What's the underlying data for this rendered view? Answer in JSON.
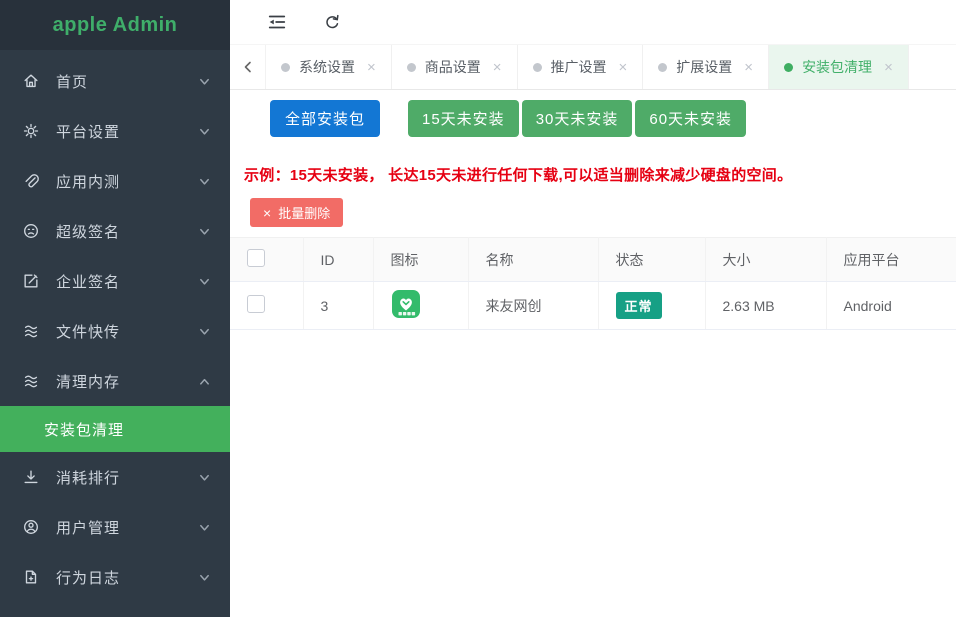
{
  "colors": {
    "accent_green": "#42b06a",
    "sidebar_bg": "#2f3a45",
    "submenu_active_bg": "#43b05c",
    "primary_blue": "#1377d4",
    "button_green": "#4fab68",
    "batch_delete_red": "#f26c66",
    "notice_red": "#e60012",
    "status_teal": "#16a085"
  },
  "sidebar": {
    "logo": "apple Admin",
    "items": [
      {
        "label": "首页",
        "icon": "home-icon"
      },
      {
        "label": "平台设置",
        "icon": "gear-icon"
      },
      {
        "label": "应用内测",
        "icon": "paperclip-icon"
      },
      {
        "label": "超级签名",
        "icon": "face-icon"
      },
      {
        "label": "企业签名",
        "icon": "edit-icon"
      },
      {
        "label": "文件快传",
        "icon": "layers-icon"
      },
      {
        "label": "清理内存",
        "icon": "layers-icon",
        "expanded": true
      },
      {
        "label": "消耗排行",
        "icon": "download-icon"
      },
      {
        "label": "用户管理",
        "icon": "user-icon"
      },
      {
        "label": "行为日志",
        "icon": "file-icon"
      }
    ],
    "active_submenu": "安装包清理"
  },
  "topbar": {
    "tabs": [
      {
        "label": "系统设置",
        "close": "×"
      },
      {
        "label": "商品设置",
        "close": "×"
      },
      {
        "label": "推广设置",
        "close": "×"
      },
      {
        "label": "扩展设置",
        "close": "×"
      },
      {
        "label": "安装包清理",
        "close": "×",
        "active": true
      }
    ]
  },
  "content": {
    "filter_buttons": {
      "all": "全部安装包",
      "d15": "15天未安装",
      "d30": "30天未安装",
      "d60": "60天未安装"
    },
    "notice": "示例：15天未安装， 长达15天未进行任何下载,可以适当删除来减少硬盘的空间。",
    "batch_delete": {
      "icon": "×",
      "label": "批量删除"
    },
    "table": {
      "columns": {
        "id": "ID",
        "icon": "图标",
        "name": "名称",
        "status": "状态",
        "size": "大小",
        "platform": "应用平台"
      },
      "rows": [
        {
          "id": "3",
          "icon": "app-icon",
          "name": "来友网创",
          "status": "正常",
          "size": "2.63 MB",
          "platform": "Android"
        }
      ]
    }
  }
}
